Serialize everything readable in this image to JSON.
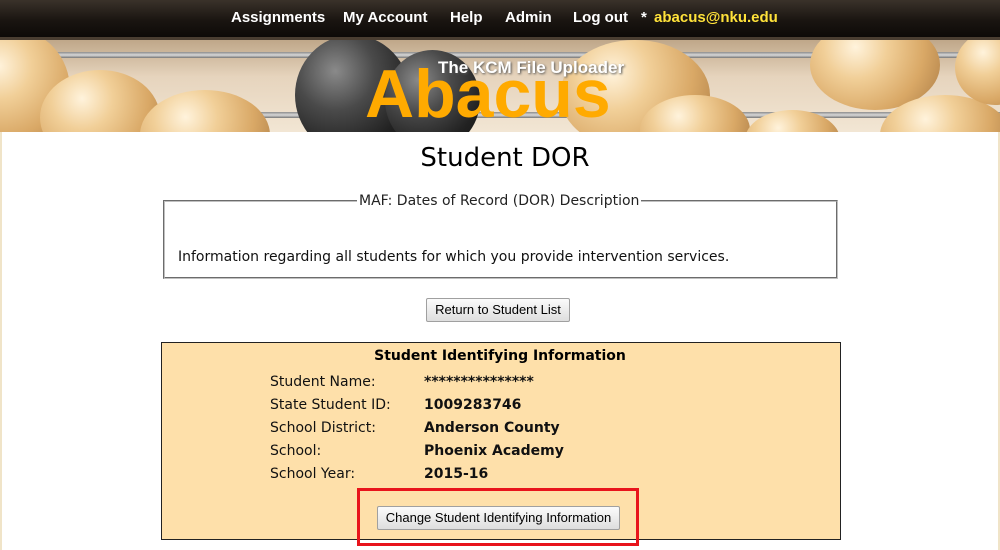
{
  "nav": {
    "assignments": "Assignments",
    "my_account": "My Account",
    "help": "Help",
    "admin": "Admin",
    "logout": "Log out",
    "star": "*",
    "user": "abacus@nku.edu"
  },
  "banner": {
    "subtitle": "The KCM File Uploader",
    "title": "Abacus"
  },
  "page": {
    "title": "Student DOR"
  },
  "description": {
    "legend": "MAF: Dates of Record (DOR) Description",
    "text": "Information regarding all students for which you provide intervention services."
  },
  "buttons": {
    "return": "Return to Student List",
    "change": "Change Student Identifying Information"
  },
  "student_info": {
    "title": "Student Identifying Information",
    "fields": [
      {
        "label": "Student Name:",
        "value": "***************"
      },
      {
        "label": "State Student ID:",
        "value": "1009283746"
      },
      {
        "label": "School District:",
        "value": "Anderson County"
      },
      {
        "label": "School:",
        "value": "Phoenix Academy"
      },
      {
        "label": "School Year:",
        "value": "2015-16"
      }
    ]
  },
  "colors": {
    "nav_user": "#ffe23a",
    "brand": "#ffaa00",
    "info_bg": "#fee0aa",
    "highlight": "#e8141c"
  }
}
